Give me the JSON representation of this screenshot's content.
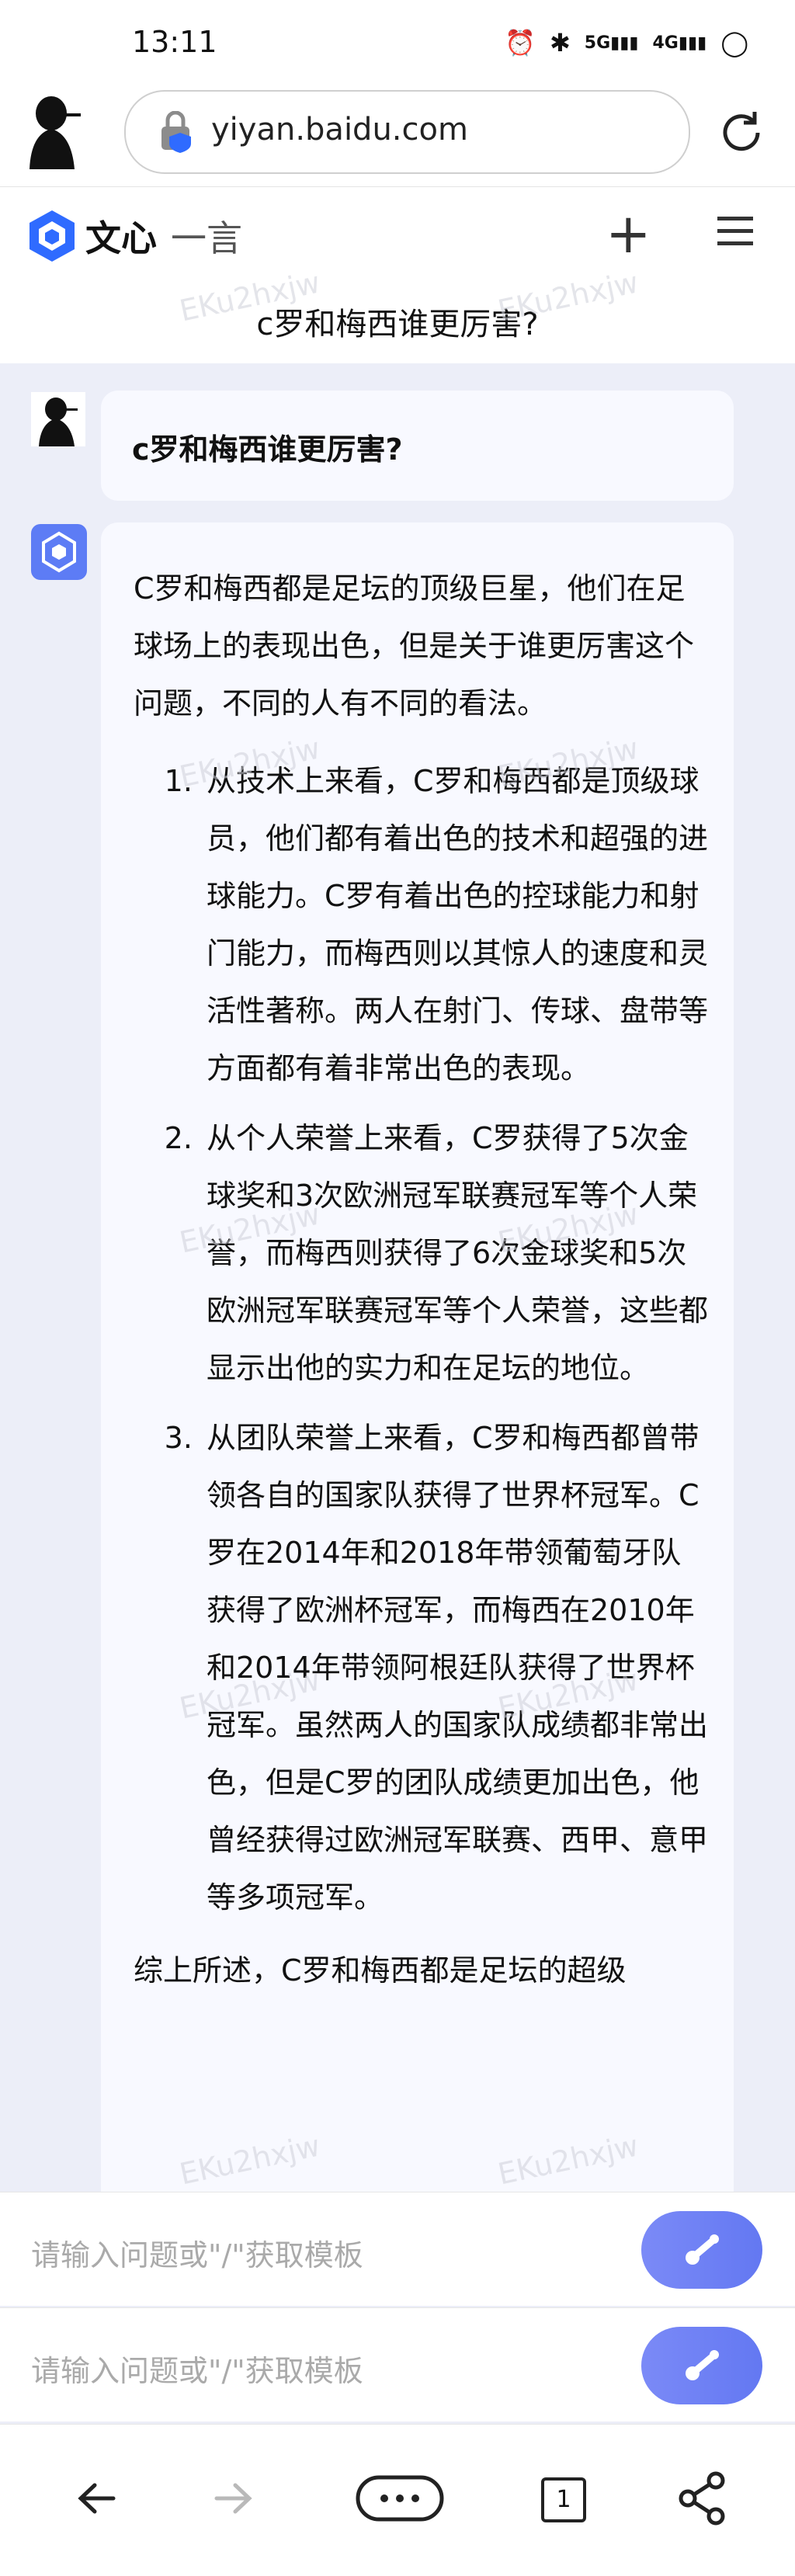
{
  "status_bar": {
    "time": "13:11",
    "icons": [
      "alarm-icon",
      "bluetooth-icon",
      "5g-signal-icon",
      "4g-signal-icon",
      "battery-icon"
    ],
    "sig1": "5G",
    "sig2": "4G"
  },
  "browser": {
    "url": "yiyan.baidu.com"
  },
  "app": {
    "brand_bold": "文心",
    "brand_light": "一言"
  },
  "conversation": {
    "title": "c罗和梅西谁更厉害?",
    "user_message": "c罗和梅西谁更厉害?",
    "bot": {
      "intro": "C罗和梅西都是足坛的顶级巨星，他们在足球场上的表现出色，但是关于谁更厉害这个问题，不同的人有不同的看法。",
      "points": [
        "从技术上来看，C罗和梅西都是顶级球员，他们都有着出色的技术和超强的进球能力。C罗有着出色的控球能力和射门能力，而梅西则以其惊人的速度和灵活性著称。两人在射门、传球、盘带等方面都有着非常出色的表现。",
        "从个人荣誉上来看，C罗获得了5次金球奖和3次欧洲冠军联赛冠军等个人荣誉，而梅西则获得了6次金球奖和5次欧洲冠军联赛冠军等个人荣誉，这些都显示出他的实力和在足坛的地位。",
        "从团队荣誉上来看，C罗和梅西都曾带领各自的国家队获得了世界杯冠军。C罗在2014年和2018年带领葡萄牙队获得了欧洲杯冠军，而梅西在2010年和2014年带领阿根廷队获得了世界杯冠军。虽然两人的国家队成绩都非常出色，但是C罗的团队成绩更加出色，他曾经获得过欧洲冠军联赛、西甲、意甲等多项冠军。"
      ],
      "conclusion": "综上所述，C罗和梅西都是足坛的超级"
    }
  },
  "input": {
    "placeholder": "请输入问题或\"/\"获取模板"
  },
  "bottom_nav": {
    "tab_count": "1"
  },
  "watermark": "EKu2hxjw",
  "colors": {
    "accent": "#6378f2",
    "logo_blue": "#2f6bff",
    "background": "#eceef8"
  }
}
